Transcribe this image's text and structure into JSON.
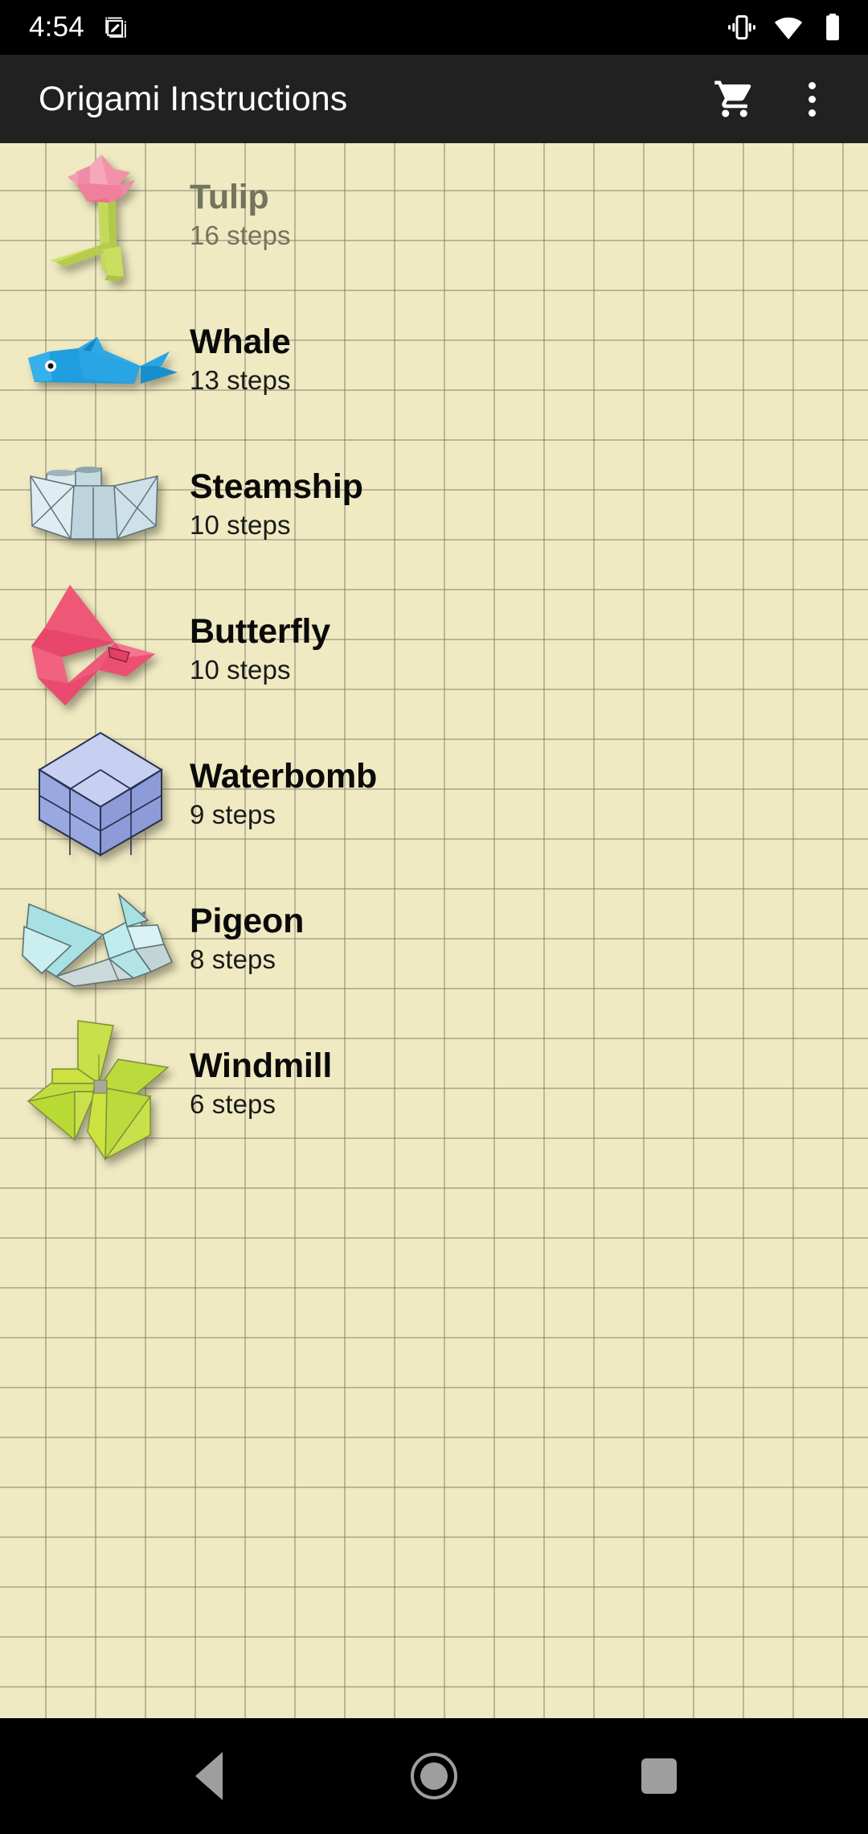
{
  "status_bar": {
    "clock": "4:54",
    "icons": [
      "screenshot-edit-icon",
      "vibrate-icon",
      "wifi-icon",
      "battery-icon"
    ]
  },
  "app_bar": {
    "title": "Origami Instructions",
    "background_color": "#212121",
    "actions": [
      {
        "name": "cart-button",
        "icon": "shopping-cart-icon"
      },
      {
        "name": "overflow-button",
        "icon": "more-vert-icon"
      }
    ]
  },
  "list": {
    "background_color": "#efeac2",
    "grid_line_color": "#7a7864",
    "items": [
      {
        "title": "Tulip",
        "steps": "16 steps",
        "state": "completed",
        "thumb": "tulip-thumbnail",
        "color": "#f2869e"
      },
      {
        "title": "Whale",
        "steps": "13 steps",
        "state": "default",
        "thumb": "whale-thumbnail",
        "color": "#2196d9"
      },
      {
        "title": "Steamship",
        "steps": "10 steps",
        "state": "default",
        "thumb": "steamship-thumbnail",
        "color": "#cdddE4"
      },
      {
        "title": "Butterfly",
        "steps": "10 steps",
        "state": "default",
        "thumb": "butterfly-thumbnail",
        "color": "#ef5572"
      },
      {
        "title": "Waterbomb",
        "steps": "9 steps",
        "state": "default",
        "thumb": "waterbomb-thumbnail",
        "color": "#9aa6dd"
      },
      {
        "title": "Pigeon",
        "steps": "8 steps",
        "state": "default",
        "thumb": "pigeon-thumbnail",
        "color": "#a8e0e0"
      },
      {
        "title": "Windmill",
        "steps": "6 steps",
        "state": "default",
        "thumb": "windmill-thumbnail",
        "color": "#bcdd33"
      }
    ]
  },
  "nav_bar": {
    "buttons": [
      "back-button",
      "home-button",
      "recents-button"
    ],
    "tint_color": "#9e9e9e"
  }
}
